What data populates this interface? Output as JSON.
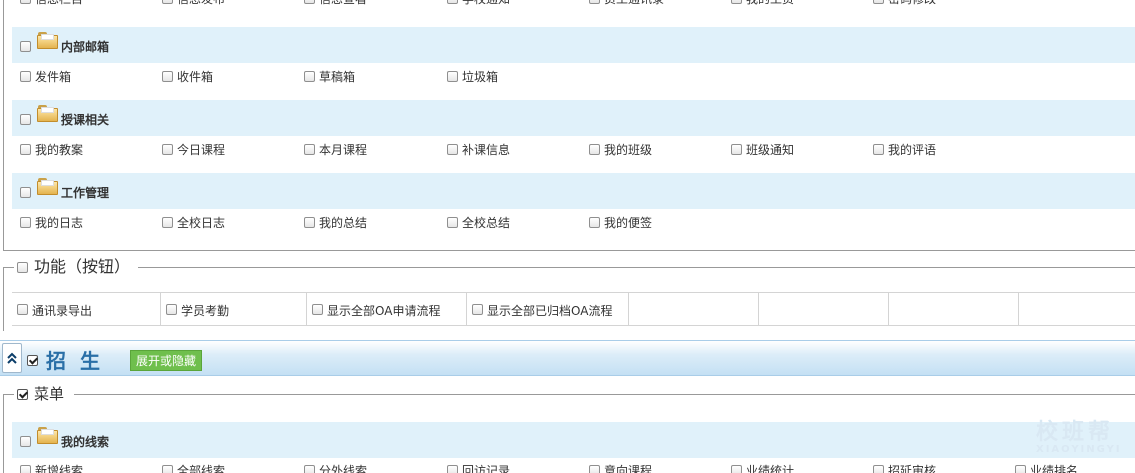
{
  "top_row_items": [
    "信息栏目",
    "信息发布",
    "信息查看",
    "学校通知",
    "员工通讯录",
    "我的工资",
    "密码修改"
  ],
  "groups": [
    {
      "title": "内部邮箱",
      "items": [
        "发件箱",
        "收件箱",
        "草稿箱",
        "垃圾箱"
      ]
    },
    {
      "title": "授课相关",
      "items": [
        "我的教案",
        "今日课程",
        "本月课程",
        "补课信息",
        "我的班级",
        "班级通知",
        "我的评语"
      ]
    },
    {
      "title": "工作管理",
      "items": [
        "我的日志",
        "全校日志",
        "我的总结",
        "全校总结",
        "我的便签"
      ]
    }
  ],
  "functions": {
    "legend": "功能（按钮）",
    "buttons": [
      "通讯录导出",
      "学员考勤",
      "显示全部OA申请流程",
      "显示全部已归档OA流程"
    ]
  },
  "module": {
    "collapse_icon": "double-chevron-up-icon",
    "collapse_glyph": "≈",
    "title": "招生",
    "checked": true,
    "toggle_label": "展开或隐藏",
    "menu_legend": "菜单",
    "menu_checked": true,
    "first_group": {
      "title": "我的线索",
      "items": [
        "新增线索",
        "全部线索",
        "分外线索",
        "回访记录",
        "意向课程",
        "业绩统计",
        "招延审核",
        "业绩排名"
      ]
    }
  },
  "watermark": {
    "line1": "校班帮",
    "line2": "XIAOYINGYI"
  },
  "colors": {
    "group_header_bg": "#e0f1fa",
    "module_title": "#2a6fa7",
    "toggle_button": "#6fbf4d"
  }
}
